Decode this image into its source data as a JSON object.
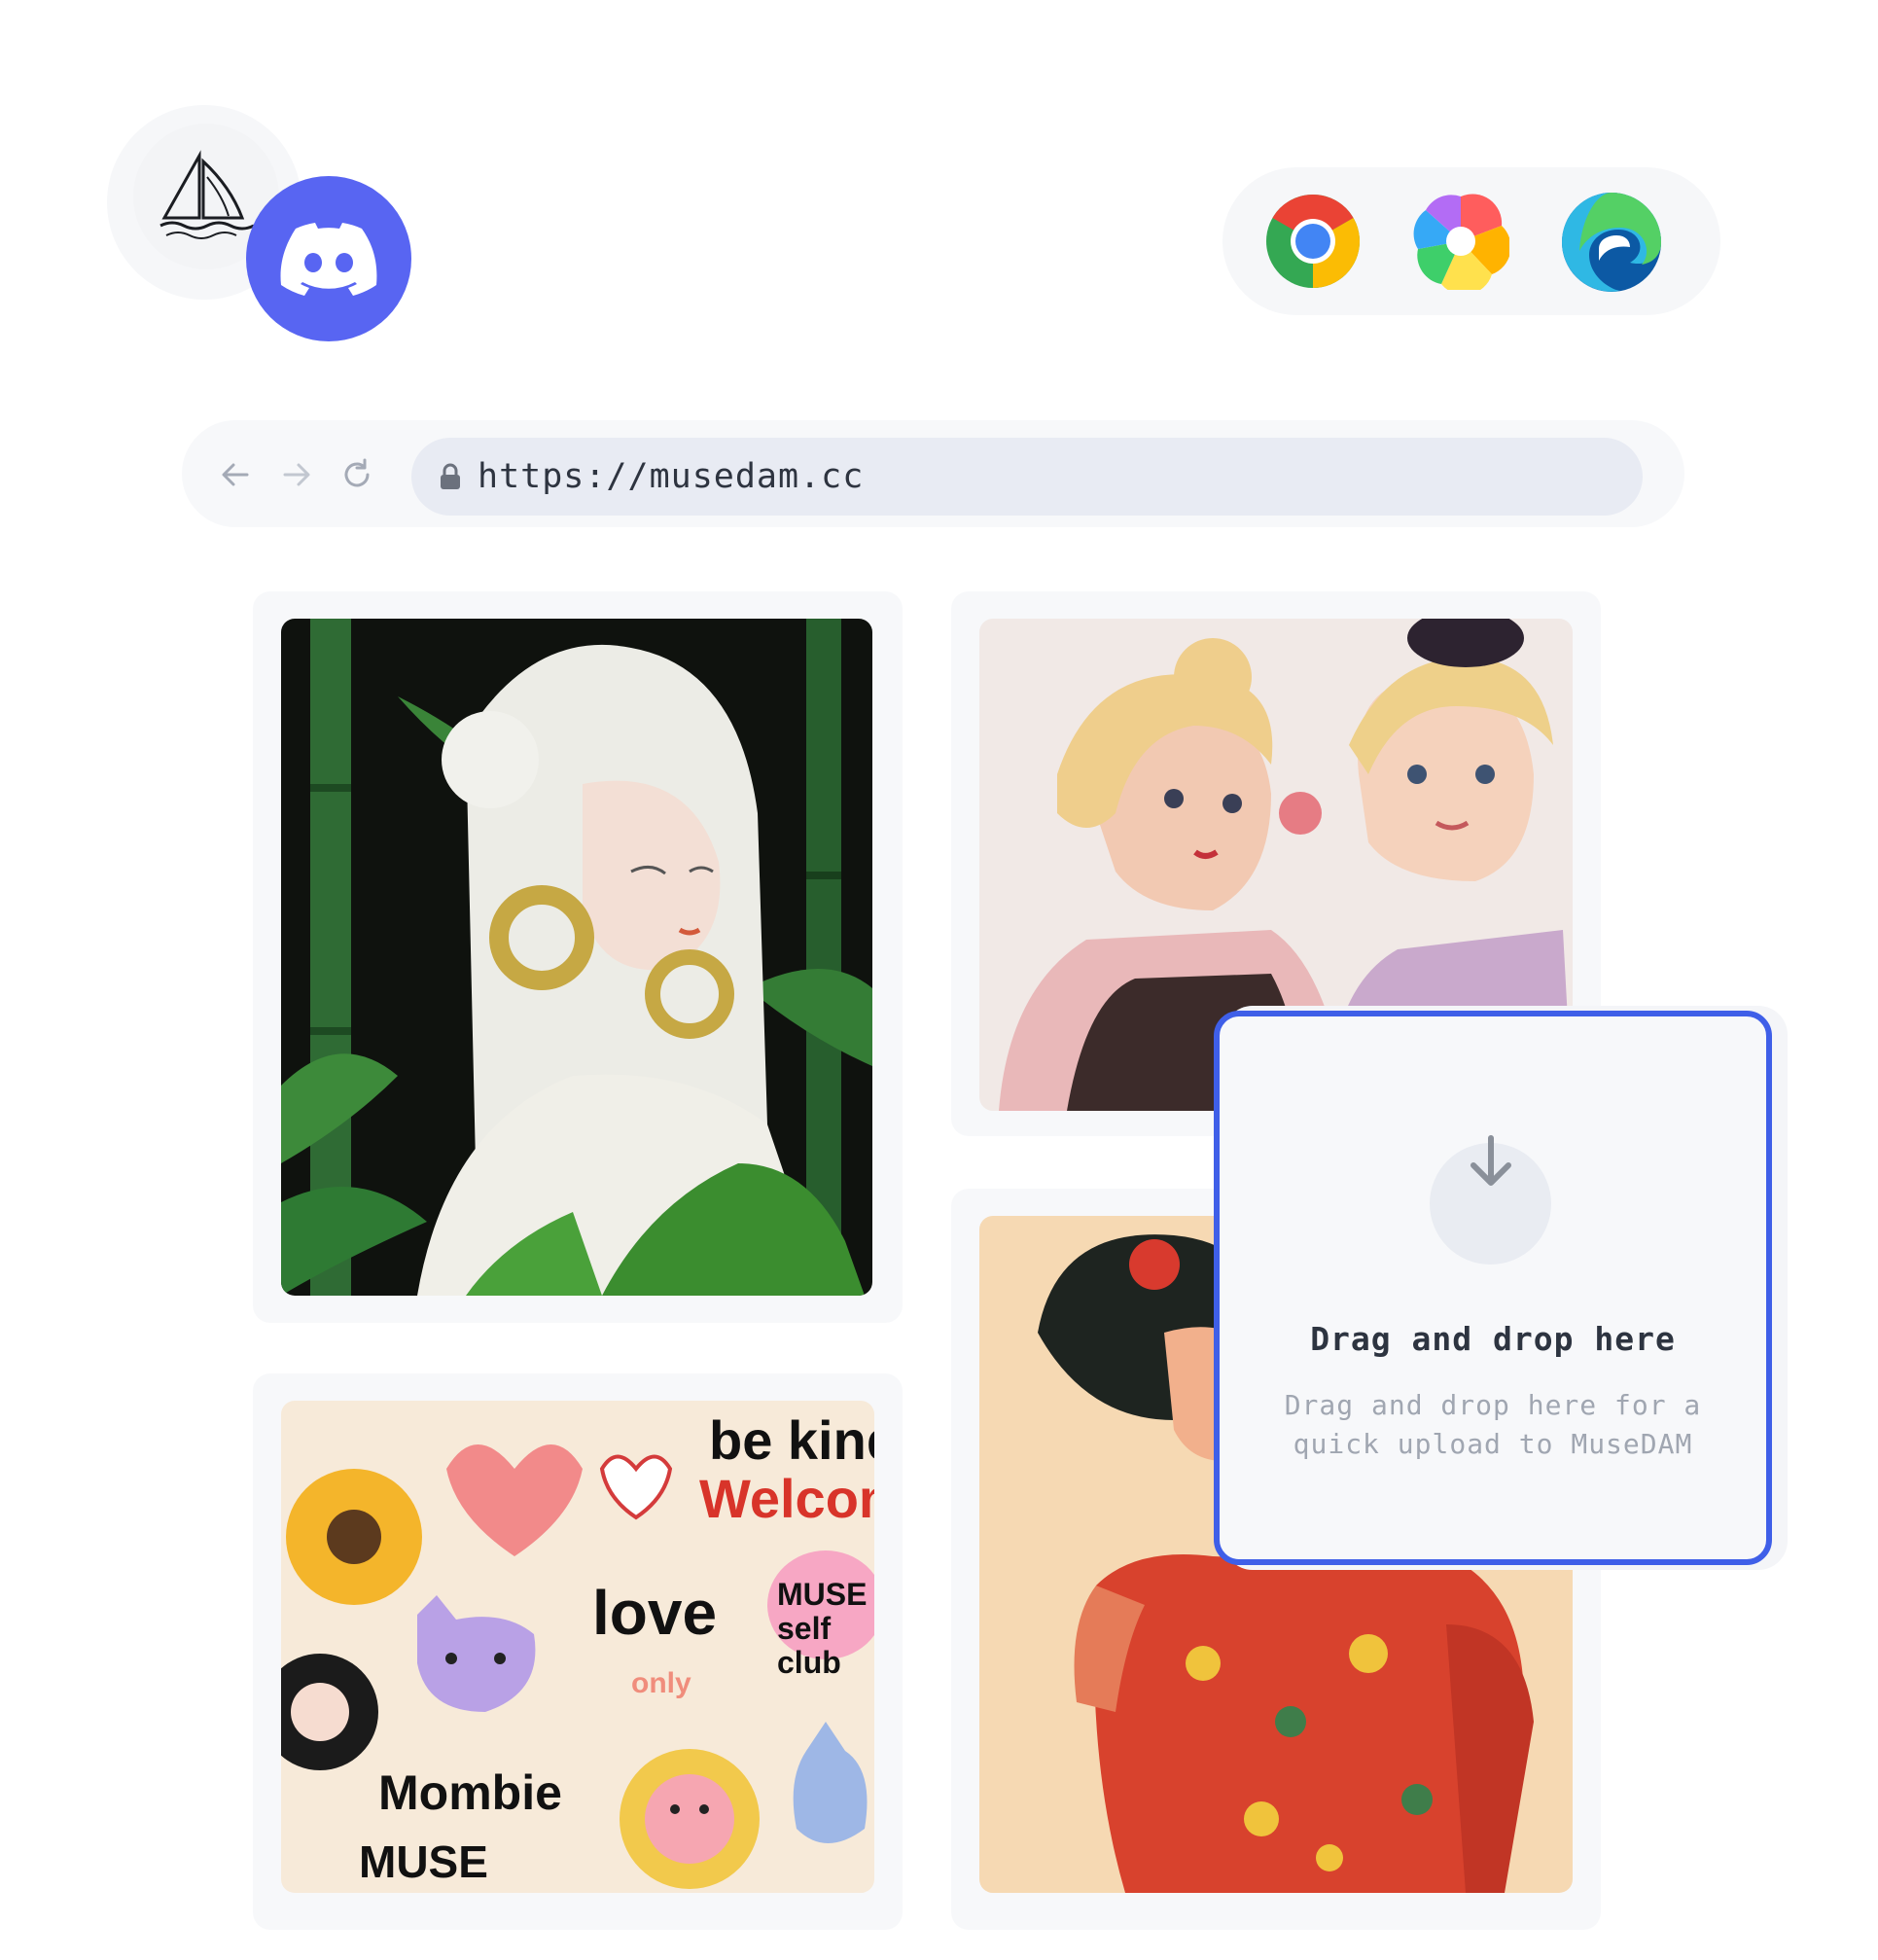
{
  "apps": {
    "left": [
      {
        "name": "Midjourney",
        "icon": "sailboat-icon"
      },
      {
        "name": "Discord",
        "icon": "discord-icon",
        "color": "#5865f2"
      }
    ],
    "browsers": [
      {
        "name": "Chrome",
        "icon": "chrome-icon"
      },
      {
        "name": "Arc",
        "icon": "arc-icon"
      },
      {
        "name": "Edge",
        "icon": "edge-icon"
      }
    ]
  },
  "address_bar": {
    "back_icon": "arrow-left-icon",
    "forward_icon": "arrow-right-icon",
    "reload_icon": "reload-icon",
    "lock_icon": "lock-icon",
    "url": "https://musedam.cc"
  },
  "gallery": {
    "images": [
      {
        "subject": "white-haired woman with gold earrings in bamboo forest"
      },
      {
        "subject": "two blonde cartoon women"
      },
      {
        "subject": "sticker collage with hearts, sunflower, cat and lion"
      },
      {
        "subject": "woman in red floral qipao"
      }
    ],
    "collage_words": [
      "be kind",
      "Welcome",
      "love",
      "MUSE self club",
      "Mombie",
      "MUSE",
      "only"
    ]
  },
  "drop_zone": {
    "icon": "download-arrow-icon",
    "title": "Drag and drop here",
    "description": "Drag and drop here for a quick upload to MuseDAM",
    "accent": "#3f5fe8"
  }
}
